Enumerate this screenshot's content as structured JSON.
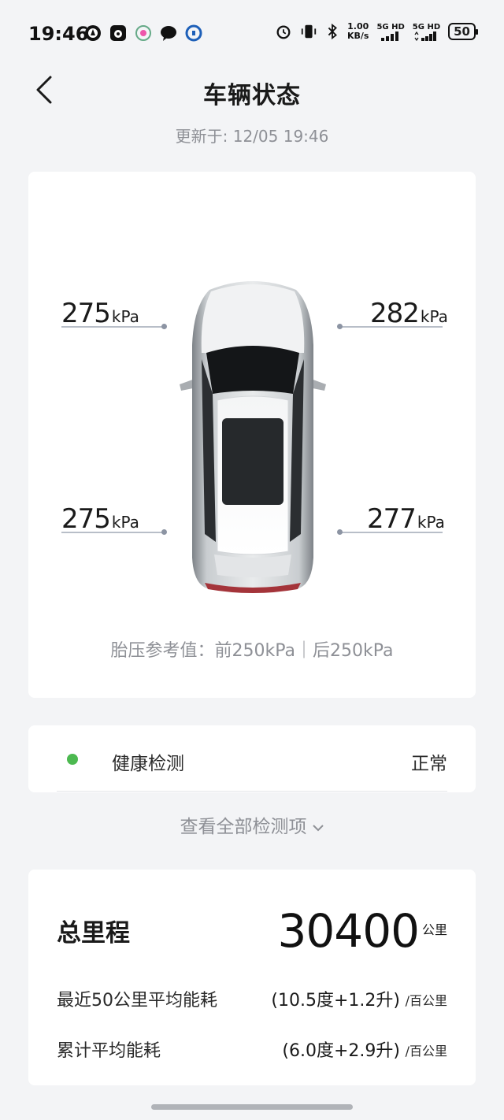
{
  "status_bar": {
    "time": "19:46",
    "net_speed_value": "1.00",
    "net_speed_unit": "KB/s",
    "sim1_label": "5G HD",
    "sim2_label": "5G HD",
    "battery": "50",
    "icons_left": [
      "compass-app-icon",
      "pet-app-icon",
      "mobile-app-icon",
      "chat-bubble-icon",
      "bank-app-icon"
    ],
    "icons_right": [
      "alarm-icon",
      "vibrate-icon",
      "bluetooth-icon"
    ]
  },
  "header": {
    "title": "车辆状态",
    "updated": "更新于: 12/05 19:46"
  },
  "tires": {
    "front_left": {
      "value": "275",
      "unit": "kPa"
    },
    "front_right": {
      "value": "282",
      "unit": "kPa"
    },
    "rear_left": {
      "value": "275",
      "unit": "kPa"
    },
    "rear_right": {
      "value": "277",
      "unit": "kPa"
    },
    "reference": "胎压参考值：前250kPa｜后250kPa"
  },
  "health": {
    "label": "健康检测",
    "status": "正常",
    "status_color": "#4cb950",
    "view_all": "查看全部检测项"
  },
  "mileage": {
    "label": "总里程",
    "value": "30400",
    "unit": "公里",
    "rows": [
      {
        "label": "最近50公里平均能耗",
        "value": "(10.5度+1.2升)",
        "unit": "/百公里"
      },
      {
        "label": "累计平均能耗",
        "value": "(6.0度+2.9升)",
        "unit": "/百公里"
      }
    ]
  }
}
